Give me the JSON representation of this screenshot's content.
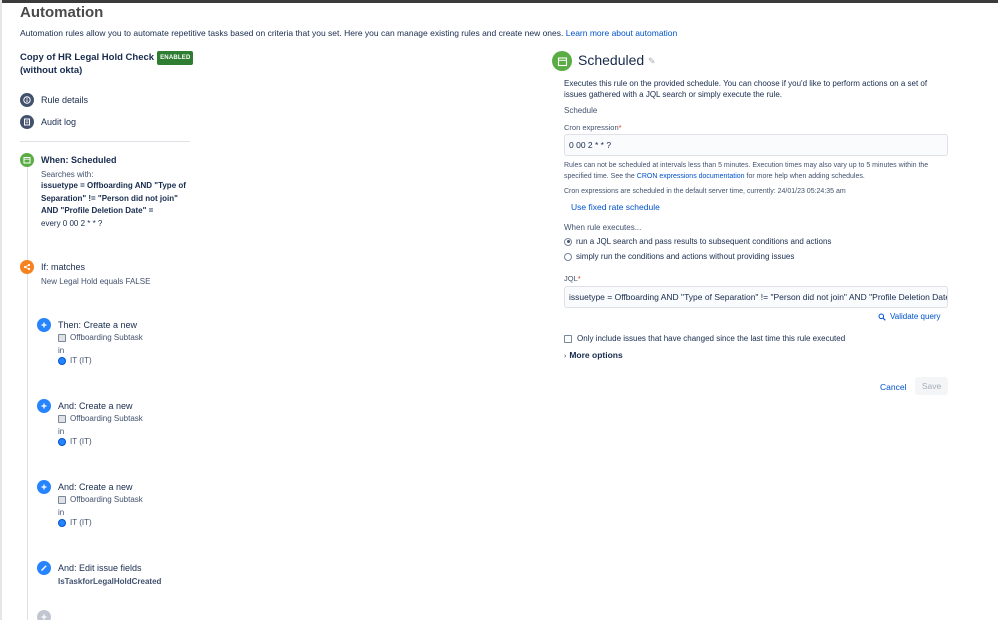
{
  "page": {
    "title": "Automation",
    "intro_text": "Automation rules allow you to automate repetitive tasks based on criteria that you set. Here you can manage existing rules and create new ones.",
    "intro_link": "Learn more about automation"
  },
  "rule": {
    "name_line1": "Copy of HR Legal Hold Check",
    "name_line2": "(without okta)",
    "status_badge": "ENABLED"
  },
  "nav": {
    "rule_details": "Rule details",
    "audit_log": "Audit log"
  },
  "trigger": {
    "title": "When: Scheduled",
    "searches_with": "Searches with:",
    "jql_line1": "issuetype = Offboarding AND \"Type of",
    "jql_line2": "Separation\" != \"Person did not join\"",
    "jql_line3": "AND \"Profile Deletion Date\" =",
    "schedule": "every 0 00 2 * * ?"
  },
  "condition": {
    "title": "If: matches",
    "text": "New Legal Hold equals FALSE"
  },
  "actions": [
    {
      "title": "Then: Create a new",
      "issue_type": "Offboarding Subtask",
      "in": "in",
      "project": "IT (IT)"
    },
    {
      "title": "And: Create a new",
      "issue_type": "Offboarding Subtask",
      "in": "in",
      "project": "IT (IT)"
    },
    {
      "title": "And: Create a new",
      "issue_type": "Offboarding Subtask",
      "in": "in",
      "project": "IT (IT)"
    }
  ],
  "edit_action": {
    "title": "And: Edit issue fields",
    "field": "IsTaskforLegalHoldCreated"
  },
  "panel": {
    "title": "Scheduled",
    "description": "Executes this rule on the provided schedule. You can choose if you'd like to perform actions on a set of issues gathered with a JQL search or simply execute the rule.",
    "schedule_label": "Schedule",
    "cron_label": "Cron expression",
    "cron_value": "0 00 2 * * ?",
    "cron_help_1": "Rules can not be scheduled at intervals less than 5 minutes. Execution times may also vary up to 5 minutes within the specified time. See the",
    "cron_help_link": "CRON expressions documentation",
    "cron_help_2": "for more help when adding schedules.",
    "server_time_text": "Cron expressions are scheduled in the default server time, currently: 24/01/23 05:24:35 am",
    "fixed_rate_link": "Use fixed rate schedule",
    "when_executes_label": "When rule executes...",
    "option_jql": "run a JQL search and pass results to subsequent conditions and actions",
    "option_simple": "simply run the conditions and actions without providing issues",
    "jql_label": "JQL",
    "jql_value": "issuetype =  Offboarding  AND  \"Type of Separation\" != \"Person did not join\"  AND  \"Profile Deletion Date",
    "validate_label": "Validate query",
    "only_changed_label": "Only include issues that have changed since the last time this rule executed",
    "more_options": "More options",
    "cancel_label": "Cancel",
    "save_label": "Save"
  },
  "colors": {
    "accent": "#0052cc",
    "enabled_badge": "#2e7d32",
    "trigger_green": "#5aac44",
    "condition_orange": "#f6821f",
    "action_blue": "#2684ff"
  }
}
